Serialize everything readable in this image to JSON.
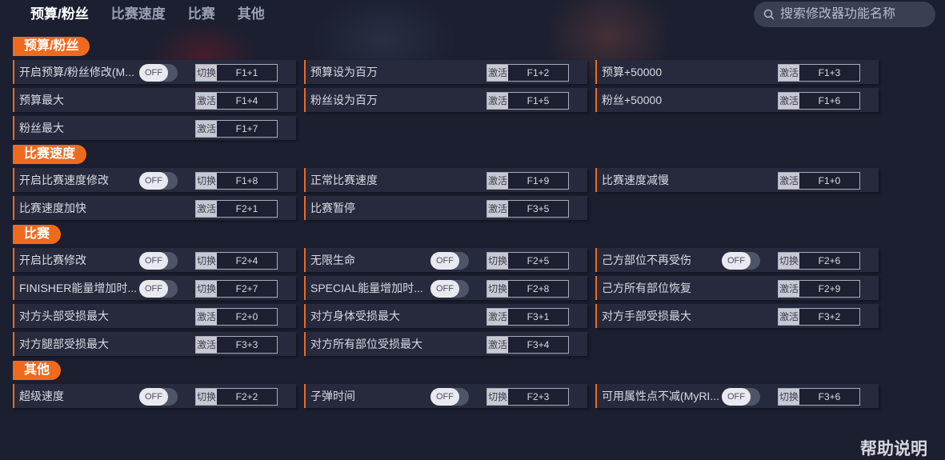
{
  "nav": {
    "tabs": [
      "预算/粉丝",
      "比赛速度",
      "比赛",
      "其他"
    ],
    "search_placeholder": "搜索修改器功能名称"
  },
  "sections": [
    {
      "title": "预算/粉丝"
    },
    {
      "title": "比赛速度"
    },
    {
      "title": "比赛"
    },
    {
      "title": "其他"
    }
  ],
  "toggle_text": "OFF",
  "rows": [
    {
      "label": "开启预算/粉丝修改(M...",
      "toggle": true,
      "mode": "切换",
      "key": "F1+1"
    },
    {
      "label": "预算设为百万",
      "toggle": false,
      "mode": "激活",
      "key": "F1+2"
    },
    {
      "label": "预算+50000",
      "toggle": false,
      "mode": "激活",
      "key": "F1+3"
    },
    {
      "label": "预算最大",
      "toggle": false,
      "mode": "激活",
      "key": "F1+4"
    },
    {
      "label": "粉丝设为百万",
      "toggle": false,
      "mode": "激活",
      "key": "F1+5"
    },
    {
      "label": "粉丝+50000",
      "toggle": false,
      "mode": "激活",
      "key": "F1+6"
    },
    {
      "label": "粉丝最大",
      "toggle": false,
      "mode": "激活",
      "key": "F1+7"
    },
    {
      "label": "开启比赛速度修改",
      "toggle": true,
      "mode": "切换",
      "key": "F1+8"
    },
    {
      "label": "正常比赛速度",
      "toggle": false,
      "mode": "激活",
      "key": "F1+9"
    },
    {
      "label": "比赛速度减慢",
      "toggle": false,
      "mode": "激活",
      "key": "F1+0"
    },
    {
      "label": "比赛速度加快",
      "toggle": false,
      "mode": "激活",
      "key": "F2+1"
    },
    {
      "label": "比赛暂停",
      "toggle": false,
      "mode": "激活",
      "key": "F3+5"
    },
    {
      "label": "开启比赛修改",
      "toggle": true,
      "mode": "切换",
      "key": "F2+4"
    },
    {
      "label": "无限生命",
      "toggle": true,
      "mode": "切换",
      "key": "F2+5"
    },
    {
      "label": "己方部位不再受伤",
      "toggle": true,
      "mode": "切换",
      "key": "F2+6"
    },
    {
      "label": "FINISHER能量增加时...",
      "toggle": true,
      "mode": "切换",
      "key": "F2+7"
    },
    {
      "label": "SPECIAL能量增加时...",
      "toggle": true,
      "mode": "切换",
      "key": "F2+8"
    },
    {
      "label": "己方所有部位恢复",
      "toggle": false,
      "mode": "激活",
      "key": "F2+9"
    },
    {
      "label": "对方头部受损最大",
      "toggle": false,
      "mode": "激活",
      "key": "F2+0"
    },
    {
      "label": "对方身体受损最大",
      "toggle": false,
      "mode": "激活",
      "key": "F3+1"
    },
    {
      "label": "对方手部受损最大",
      "toggle": false,
      "mode": "激活",
      "key": "F3+2"
    },
    {
      "label": "对方腿部受损最大",
      "toggle": false,
      "mode": "激活",
      "key": "F3+3"
    },
    {
      "label": "对方所有部位受损最大",
      "toggle": false,
      "mode": "激活",
      "key": "F3+4"
    },
    {
      "label": "超级速度",
      "toggle": true,
      "mode": "切换",
      "key": "F2+2"
    },
    {
      "label": "子弹时间",
      "toggle": true,
      "mode": "切换",
      "key": "F2+3"
    },
    {
      "label": "可用属性点不减(MyRI...",
      "toggle": true,
      "mode": "切换",
      "key": "F3+6"
    }
  ],
  "help_label": "帮助说明",
  "colors": {
    "accent": "#f06a1e",
    "row_bg": "#262a3c",
    "page_bg": "#1b1f30"
  },
  "icons": {
    "search": "search-icon"
  }
}
